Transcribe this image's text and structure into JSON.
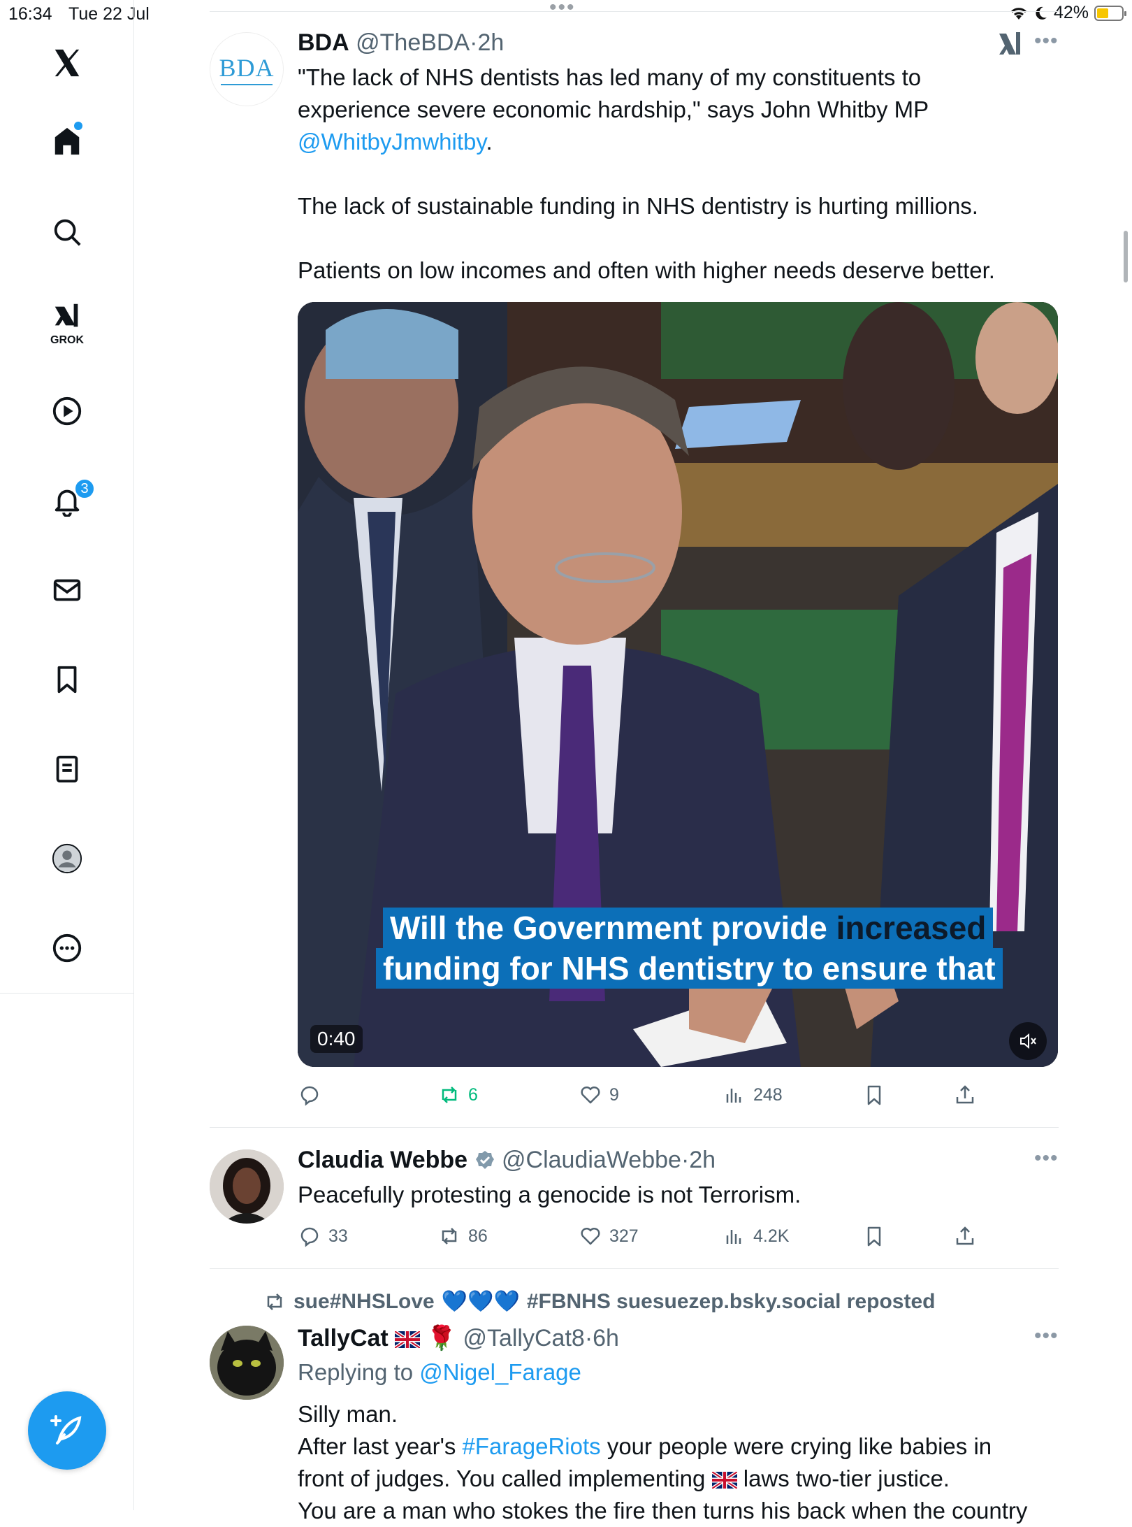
{
  "status_bar": {
    "time": "16:34",
    "date": "Tue 22 Jul",
    "battery": "42%"
  },
  "sidebar": {
    "items": [
      "home",
      "search",
      "grok",
      "videos",
      "notifications",
      "messages",
      "bookmarks",
      "lists",
      "profile",
      "more"
    ],
    "grok_label": "GROK",
    "notifications_count": "3"
  },
  "posts": [
    {
      "name": "BDA",
      "handle": "@TheBDA",
      "time": "2h",
      "text_line1": "\"The lack of NHS dentists has led many of my constituents to",
      "text_line2": "experience severe economic hardship,\" says John Whitby MP",
      "mention": "@WhitbyJmwhitby",
      "mention_suffix": ".",
      "text_para2": "The lack of sustainable funding in NHS dentistry is hurting millions.",
      "text_para3": "Patients on low incomes and often with higher needs deserve better.",
      "video": {
        "caption_line1_a": "Will the Government provide ",
        "caption_line1_b": "increased",
        "caption_line2": "funding for NHS dentistry to ensure that",
        "duration": "0:40"
      },
      "stats": {
        "replies": "",
        "reposts": "6",
        "likes": "9",
        "views": "248"
      },
      "avatar_logo": "BDA"
    },
    {
      "name": "Claudia Webbe",
      "handle": "@ClaudiaWebbe",
      "time": "2h",
      "text": "Peacefully protesting a genocide is not Terrorism.",
      "stats": {
        "replies": "33",
        "reposts": "86",
        "likes": "327",
        "views": "4.2K"
      }
    },
    {
      "repost_by_a": "sue#NHSLove",
      "repost_by_b": "#FBNHS suesuezep.bsky.social reposted",
      "name": "TallyCat",
      "handle": "@TallyCat8",
      "time": "6h",
      "replying_prefix": "Replying to ",
      "replying_to": "@Nigel_Farage",
      "line1": "Silly man.",
      "line2_a": "After last year's ",
      "line2_tag": "#FarageRiots",
      "line2_b": " your people were crying like babies in",
      "line3_a": "front of judges. You called implementing ",
      "line3_b": " laws two-tier justice.",
      "line4": "You are a man who stokes the fire then turns his back when the country"
    }
  ]
}
